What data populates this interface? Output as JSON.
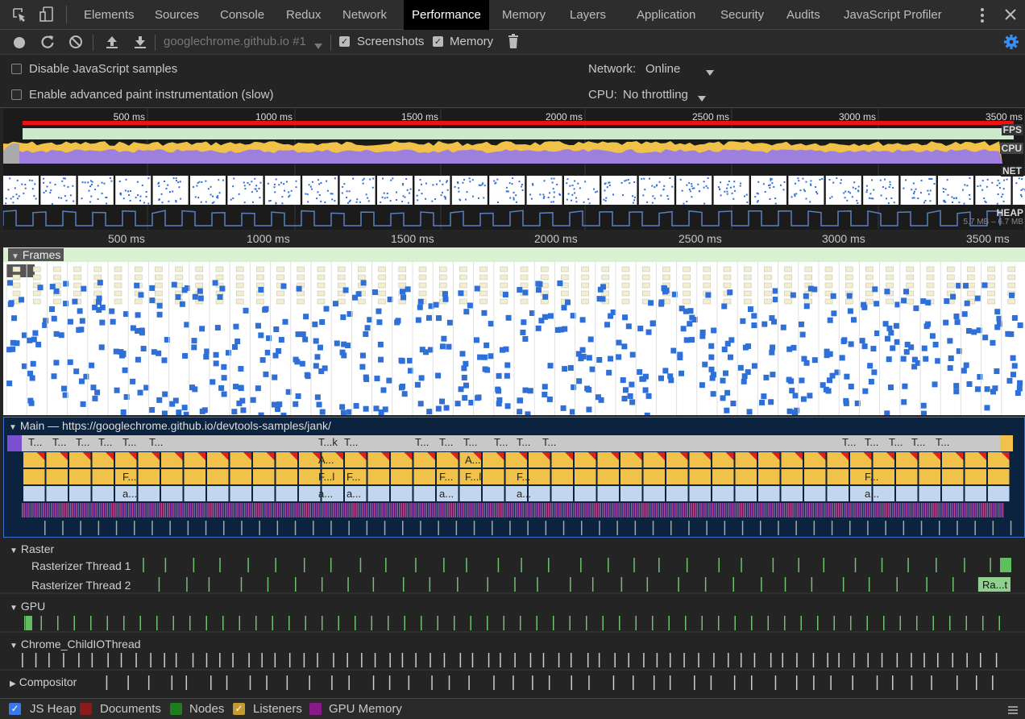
{
  "tabs": [
    "Elements",
    "Sources",
    "Console",
    "Redux",
    "Network",
    "Performance",
    "Memory",
    "Layers",
    "Application",
    "Security",
    "Audits",
    "JavaScript Profiler"
  ],
  "active_tab": "Performance",
  "toolbar": {
    "recording_select": "googlechrome.github.io #1",
    "screenshots_label": "Screenshots",
    "memory_label": "Memory"
  },
  "options": {
    "disable_js_samples": "Disable JavaScript samples",
    "advanced_paint": "Enable advanced paint instrumentation (slow)",
    "network_label": "Network:",
    "network_value": "Online",
    "cpu_label": "CPU:",
    "cpu_value": "No throttling"
  },
  "overview": {
    "ticks": [
      "500 ms",
      "1000 ms",
      "1500 ms",
      "2000 ms",
      "2500 ms",
      "3000 ms",
      "3500 ms"
    ],
    "fps_label": "FPS",
    "cpu_label": "CPU",
    "net_label": "NET",
    "heap_label": "HEAP",
    "heap_range": "5.7 MB – 6.7 MB"
  },
  "timeline_ticks": [
    "500 ms",
    "1000 ms",
    "1500 ms",
    "2000 ms",
    "2500 ms",
    "3000 ms",
    "3500 ms"
  ],
  "frames_label": "Frames",
  "main": {
    "title": "Main — https://googlechrome.github.io/devtools-samples/jank/",
    "row1_labels": [
      "T...",
      "T...",
      "T...",
      "T...",
      "T...",
      "T...",
      "T...k",
      "T...",
      "T...",
      "T...",
      "T...",
      "T...",
      "T...",
      "T...",
      "T...",
      "T...",
      "T...",
      "T...",
      "T..."
    ],
    "row2_labels": [
      "A...",
      "A..."
    ],
    "row3_labels": [
      "F...",
      "F...l",
      "F...",
      "F...",
      "F...l",
      "F...",
      "F..."
    ],
    "row4_labels": [
      "a...",
      "a...",
      "a...",
      "a...",
      "a...",
      "a..."
    ]
  },
  "raster": {
    "label": "Raster",
    "thread1": "Rasterizer Thread 1",
    "thread2": "Rasterizer Thread 2",
    "thread2_event": "Ra...t"
  },
  "gpu_label": "GPU",
  "io_label": "Chrome_ChildIOThread",
  "compositor_label": "Compositor",
  "legend": {
    "items": [
      {
        "label": "JS Heap",
        "color": "#3b78e7",
        "checked": true
      },
      {
        "label": "Documents",
        "color": "#8b1a1a",
        "checked": false
      },
      {
        "label": "Nodes",
        "color": "#1e7d1e",
        "checked": false
      },
      {
        "label": "Listeners",
        "color": "#c79a2e",
        "checked": true
      },
      {
        "label": "GPU Memory",
        "color": "#8a1a8a",
        "checked": false
      }
    ]
  }
}
